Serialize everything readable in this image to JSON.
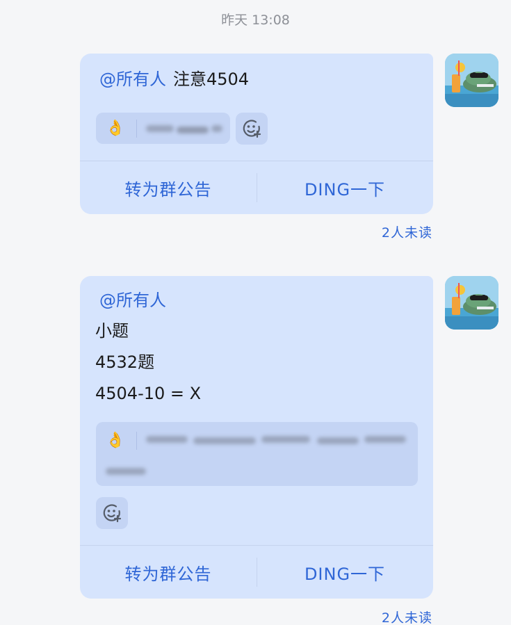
{
  "timestamp": "昨天 13:08",
  "messages": [
    {
      "mention": "@所有人",
      "text": "注意4504",
      "reaction_emoji": "👌",
      "actions": {
        "announce": "转为群公告",
        "ding": "DING一下"
      },
      "read_status": "2人未读"
    },
    {
      "mention": "@所有人",
      "lines": [
        "小题",
        "4532题",
        "4504-10 = X"
      ],
      "reaction_emoji": "👌",
      "actions": {
        "announce": "转为群公告",
        "ding": "DING一下"
      },
      "read_status": "2人未读"
    }
  ],
  "colors": {
    "bubble": "#d6e4fd",
    "accent": "#2f66d6",
    "background": "#f5f6f8"
  },
  "icons": {
    "emoji_reaction": "add-reaction-icon",
    "avatar": "crocodile-avatar"
  }
}
